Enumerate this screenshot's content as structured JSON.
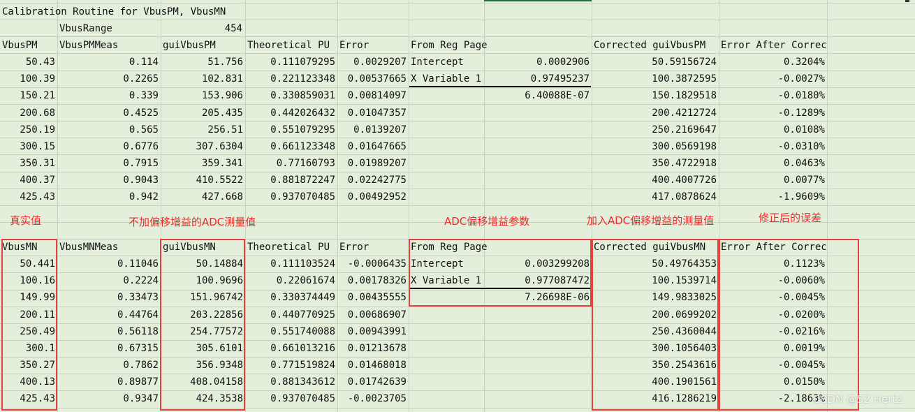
{
  "sheet": {
    "title": "Calibration Routine for VbusPM, VbusMN",
    "range_label": "VbusRange",
    "range_value": "454"
  },
  "pm": {
    "headers": [
      "VbusPM",
      "VbusPMMeas",
      "guiVbusPM",
      "Theoretical PU",
      "Error",
      "From Reg Page",
      "",
      "Corrected guiVbusPM",
      "Error After Correction"
    ],
    "rows": [
      [
        "50.43",
        "0.114",
        "51.756",
        "0.111079295",
        "0.0029207",
        "Intercept",
        "0.0002906",
        "50.59156724",
        "0.3204%"
      ],
      [
        "100.39",
        "0.2265",
        "102.831",
        "0.221123348",
        "0.00537665",
        "X Variable 1",
        "0.97495237",
        "100.3872595",
        "-0.0027%"
      ],
      [
        "150.21",
        "0.339",
        "153.906",
        "0.330859031",
        "0.00814097",
        "",
        "6.40088E-07",
        "150.1829518",
        "-0.0180%"
      ],
      [
        "200.68",
        "0.4525",
        "205.435",
        "0.442026432",
        "0.01047357",
        "",
        "",
        "200.4212724",
        "-0.1289%"
      ],
      [
        "250.19",
        "0.565",
        "256.51",
        "0.551079295",
        "0.0139207",
        "",
        "",
        "250.2169647",
        "0.0108%"
      ],
      [
        "300.15",
        "0.6776",
        "307.6304",
        "0.661123348",
        "0.01647665",
        "",
        "",
        "300.0569198",
        "-0.0310%"
      ],
      [
        "350.31",
        "0.7915",
        "359.341",
        "0.77160793",
        "0.01989207",
        "",
        "",
        "350.4722918",
        "0.0463%"
      ],
      [
        "400.37",
        "0.9043",
        "410.5522",
        "0.881872247",
        "0.02242775",
        "",
        "",
        "400.4007726",
        "0.0077%"
      ],
      [
        "425.43",
        "0.942",
        "427.668",
        "0.937070485",
        "0.00492952",
        "",
        "",
        "417.0878624",
        "-1.9609%"
      ]
    ]
  },
  "annotations": {
    "true_value": "真实值",
    "adc_no_offset": "不加偏移增益的ADC测量值",
    "adc_params": "ADC偏移增益参数",
    "adc_with_offset": "加入ADC偏移增益的测量值",
    "corrected_error": "修正后的误差"
  },
  "mn": {
    "headers": [
      "VbusMN",
      "VbusMNMeas",
      "guiVbusMN",
      "Theoretical PU",
      "Error",
      "From Reg Page",
      "",
      "Corrected guiVbusMN",
      "Error After Correction"
    ],
    "rows": [
      [
        "50.441",
        "0.11046",
        "50.14884",
        "0.111103524",
        "-0.0006435",
        "Intercept",
        "0.003299208",
        "50.49764353",
        "0.1123%"
      ],
      [
        "100.16",
        "0.2224",
        "100.9696",
        "0.22061674",
        "0.00178326",
        "X Variable 1",
        "0.977087472",
        "100.1539714",
        "-0.0060%"
      ],
      [
        "149.99",
        "0.33473",
        "151.96742",
        "0.330374449",
        "0.00435555",
        "",
        "7.26698E-06",
        "149.9833025",
        "-0.0045%"
      ],
      [
        "200.11",
        "0.44764",
        "203.22856",
        "0.440770925",
        "0.00686907",
        "",
        "",
        "200.0699202",
        "-0.0200%"
      ],
      [
        "250.49",
        "0.56118",
        "254.77572",
        "0.551740088",
        "0.00943991",
        "",
        "",
        "250.4360044",
        "-0.0216%"
      ],
      [
        "300.1",
        "0.67315",
        "305.6101",
        "0.661013216",
        "0.01213678",
        "",
        "",
        "300.1056403",
        "0.0019%"
      ],
      [
        "350.27",
        "0.7862",
        "356.9348",
        "0.771519824",
        "0.01468018",
        "",
        "",
        "350.2543616",
        "-0.0045%"
      ],
      [
        "400.13",
        "0.89877",
        "408.04158",
        "0.881343612",
        "0.01742639",
        "",
        "",
        "400.1901561",
        "0.0150%"
      ],
      [
        "425.43",
        "0.9347",
        "424.3538",
        "0.937070485",
        "-0.0023705",
        "",
        "",
        "416.1286219",
        "-2.1863%"
      ]
    ]
  },
  "watermark": "CSDN @52 Hertz.",
  "colors": {
    "sheet_background": "#e3efdb",
    "gridline": "#c6d2bf",
    "annotation_red": "#ee2a2a"
  }
}
